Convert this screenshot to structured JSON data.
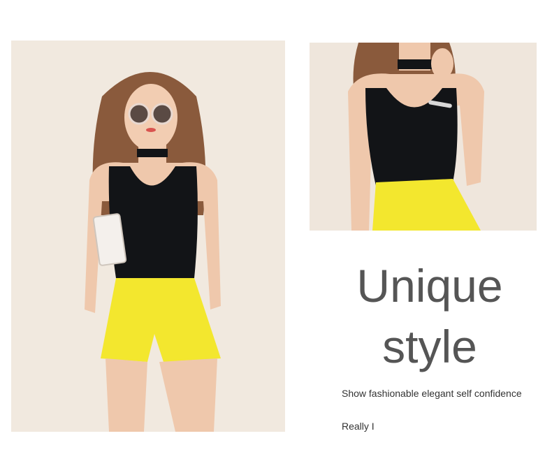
{
  "photos": {
    "left_alt": "model full body",
    "right_alt": "model close-up"
  },
  "headline": {
    "line1": "Unique",
    "line2": "style"
  },
  "tagline": "Show fashionable elegant self confidence",
  "signoff": "Really I",
  "colors": {
    "background": "#ffffff",
    "wall": "#efe6dc",
    "top": "#121417",
    "shorts": "#f3e72e",
    "skin": "#efc8ac",
    "hair": "#8a5a3c",
    "headline_text": "#555555",
    "body_text": "#333333"
  }
}
